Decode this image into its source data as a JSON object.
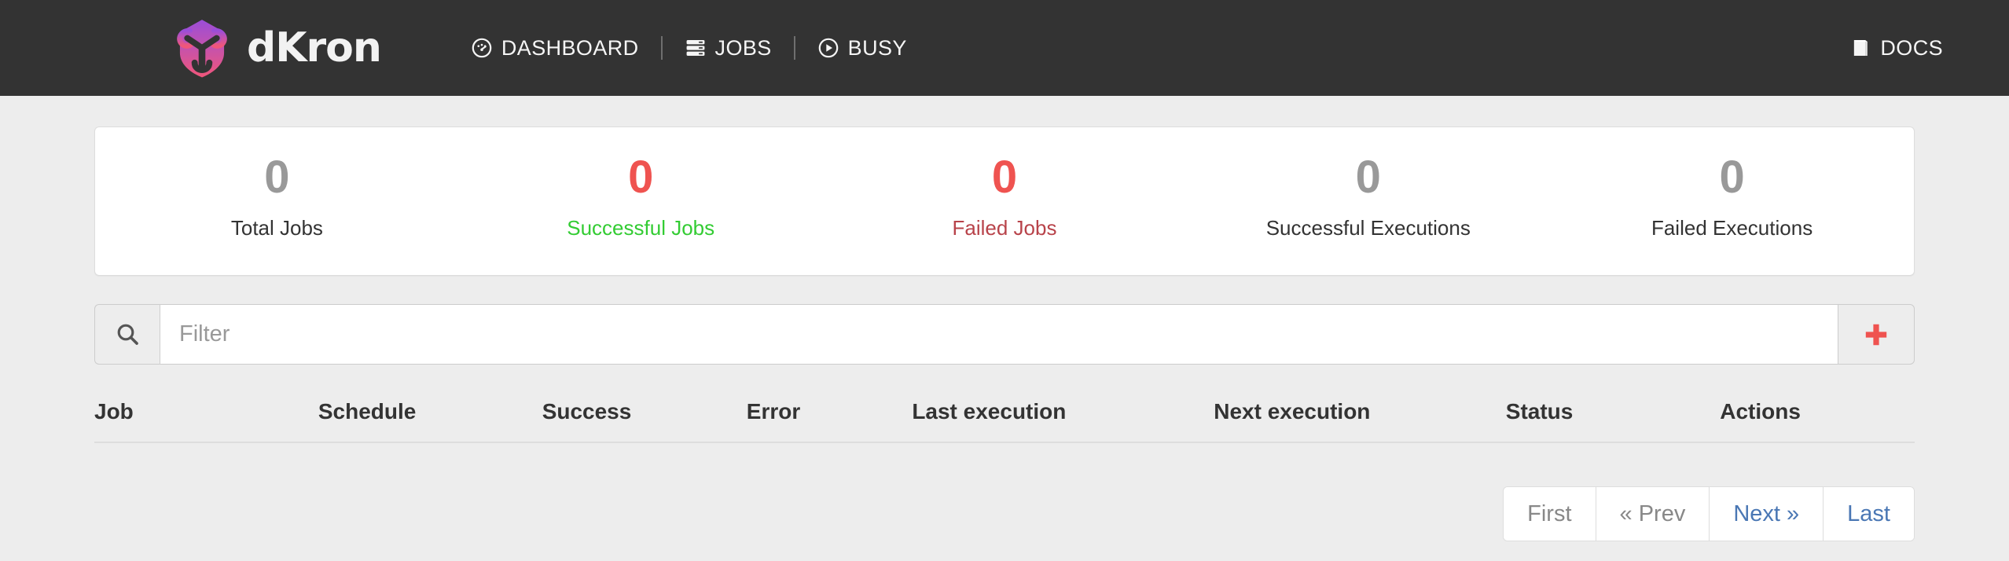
{
  "navbar": {
    "brand": {
      "text": "dKron",
      "logo_icon": "dkron-octopus-logo"
    },
    "links": [
      {
        "label": "DASHBOARD",
        "icon": "tachometer-icon"
      },
      {
        "label": "JOBS",
        "icon": "server-stack-icon"
      },
      {
        "label": "BUSY",
        "icon": "play-circle-icon"
      }
    ],
    "right_links": [
      {
        "label": "DOCS",
        "icon": "book-icon"
      }
    ],
    "background_color": "#333333"
  },
  "stats": {
    "items": [
      {
        "value": "0",
        "label": "Total Jobs",
        "value_color": "#999999",
        "label_color": "#333333"
      },
      {
        "value": "0",
        "label": "Successful Jobs",
        "value_color": "#ef5350",
        "label_color": "#33cc33"
      },
      {
        "value": "0",
        "label": "Failed Jobs",
        "value_color": "#ef5350",
        "label_color": "#b8434a"
      },
      {
        "value": "0",
        "label": "Successful Executions",
        "value_color": "#999999",
        "label_color": "#333333"
      },
      {
        "value": "0",
        "label": "Failed Executions",
        "value_color": "#999999",
        "label_color": "#333333"
      }
    ]
  },
  "filter": {
    "placeholder": "Filter",
    "value": "",
    "search_icon": "search-icon",
    "add_button_icon": "plus-icon",
    "add_button_color": "#ef5350"
  },
  "table": {
    "columns": [
      "Job",
      "Schedule",
      "Success",
      "Error",
      "Last execution",
      "Next execution",
      "Status",
      "Actions"
    ],
    "rows": []
  },
  "pagination": {
    "buttons": [
      {
        "label": "First",
        "state": "disabled"
      },
      {
        "label": "« Prev",
        "state": "disabled"
      },
      {
        "label": "Next »",
        "state": "active"
      },
      {
        "label": "Last",
        "state": "active"
      }
    ],
    "active_color": "#4a77b4",
    "disabled_color": "#888888"
  }
}
